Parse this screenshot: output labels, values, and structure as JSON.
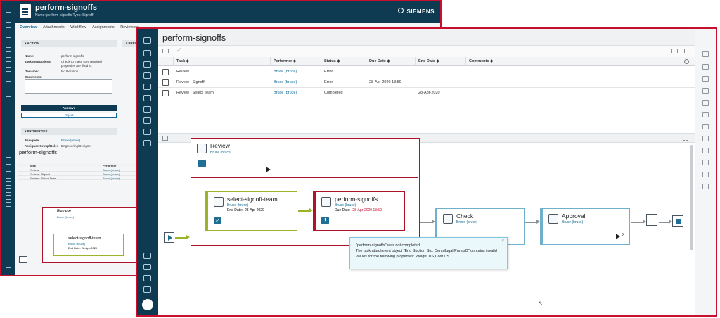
{
  "back_window": {
    "title": "perform-signoffs",
    "subtitle": "Name: perform-signoffs          Type: Signoff",
    "brand": "SIEMENS",
    "tabs": [
      "Overview",
      "Attachments",
      "Workflow",
      "Assignments",
      "Reviewers"
    ],
    "action_section": "ACTION",
    "preview_section": "PREVI",
    "fields": [
      {
        "label": "Name:",
        "value": "perform-signoffs"
      },
      {
        "label": "Task Instructions:",
        "value": "Check to make sure required"
      },
      {
        "label": "",
        "value": "properties are filled in."
      },
      {
        "label": "Decision:",
        "value": "No Decision"
      },
      {
        "label": "Comments:",
        "value": ""
      }
    ],
    "approve_label": "Approve",
    "reject_label": "Reject",
    "properties_section": "PROPERTIES",
    "properties": [
      {
        "label": "Assignee:",
        "value": "Bruce (bruce)"
      },
      {
        "label": "Assignee Group/Role:",
        "value": "Engineering/Designer"
      }
    ],
    "panel_title": "perform-signoffs",
    "mini_table": {
      "headers": [
        "Task",
        "Performer"
      ],
      "rows": [
        {
          "task": "Review",
          "performer": "Bruce (bruce)"
        },
        {
          "task": "Review : Signoff",
          "performer": "Bruce (bruce)"
        },
        {
          "task": "Review : Select Team",
          "performer": "Bruce (bruce)"
        }
      ]
    },
    "mini_wf": {
      "review": "Review",
      "review_user": "Bruce (bruce)",
      "team": "select-signoff-team",
      "team_user": "Bruce (bruce)",
      "team_end": "End Date:   28-Apr-2020"
    }
  },
  "front_window": {
    "title": "perform-signoffs",
    "columns": [
      "Task",
      "Performer",
      "Status",
      "Due Date",
      "End Date",
      "Comments"
    ],
    "rows": [
      {
        "task": "Review",
        "performer": "Bruce (bruce)",
        "status": "Error",
        "due": "",
        "end": "",
        "comments": ""
      },
      {
        "task": "Review : Signoff",
        "performer": "Bruce (bruce)",
        "status": "Error",
        "due": "28-Apr-2020 13:59",
        "end": "",
        "comments": ""
      },
      {
        "task": "Review : Select Team",
        "performer": "Bruce (bruce)",
        "status": "Completed",
        "due": "",
        "end": "28-Apr-2020",
        "comments": ""
      }
    ],
    "workflow": {
      "review": {
        "label": "Review",
        "user": "Bruce (bruce)"
      },
      "select_team": {
        "label": "select-signoff-team",
        "user": "Bruce (bruce)",
        "end_label": "End Date:",
        "end_value": "28-Apr-2020"
      },
      "perform": {
        "label": "perform-signoffs",
        "user": "Bruce (bruce)",
        "due_label": "Due Date:",
        "due_value": "28-Apr-2020 13:59"
      },
      "check": {
        "label": "Check",
        "user": "Bruce (bruce)"
      },
      "approval": {
        "label": "Approval",
        "user": "Bruce (bruce)",
        "count": "2"
      }
    },
    "tooltip": {
      "line1": "\"perform-signoffs\" was not completed.",
      "line2": "The task attachment object \"End Suction Std. Centrifugal Pump/B\" contains invalid values for the following properties: Weight US,Cost US"
    },
    "colors": {
      "rail": "#0f3b52",
      "review_border": "#b01227",
      "team_border": "#9ab52a",
      "check_border": "#6fb1cd",
      "link": "#0f6a96"
    }
  }
}
